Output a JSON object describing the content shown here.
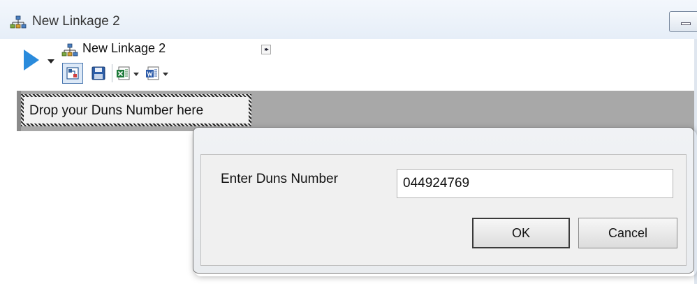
{
  "window": {
    "title": "New Linkage 2",
    "icon": "linkage-network-icon"
  },
  "toolbar": {
    "linkage_name": "New Linkage 2",
    "expand_glyph": "▸▸",
    "icons": [
      "play-icon",
      "connect-icon",
      "save-icon",
      "excel-export-icon",
      "word-export-icon"
    ]
  },
  "canvas": {
    "drop_zone_label": "Drop your Duns Number here"
  },
  "dialog": {
    "label": "Enter Duns Number",
    "input_value": "044924769",
    "ok_label": "OK",
    "cancel_label": "Cancel"
  },
  "colors": {
    "play": "#2a8bdc",
    "canvas_band": "#a8a8a8"
  }
}
